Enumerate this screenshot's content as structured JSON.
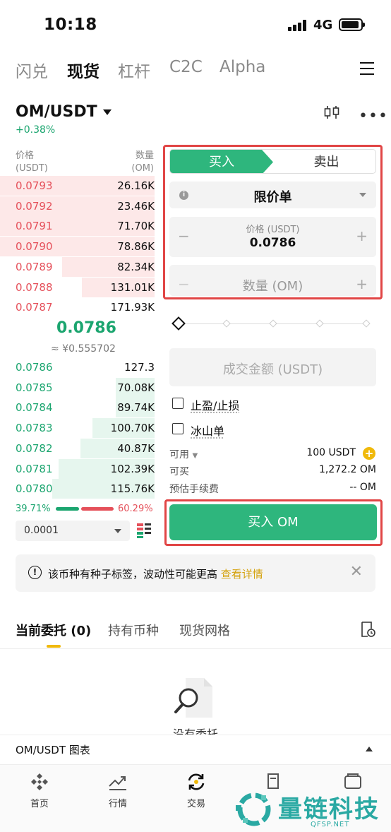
{
  "status": {
    "time": "10:18",
    "network": "4G"
  },
  "top_tabs": [
    "闪兑",
    "现货",
    "杠杆",
    "C2C",
    "Alpha"
  ],
  "pair": {
    "name": "OM/USDT",
    "change": "+0.38%"
  },
  "orderbook": {
    "price_header": "价格",
    "price_unit": "(USDT)",
    "qty_header": "数量",
    "qty_unit": "(OM)",
    "asks": [
      {
        "price": "0.0793",
        "qty": "26.16K",
        "depth": 0.27
      },
      {
        "price": "0.0792",
        "qty": "23.46K",
        "depth": 0.25
      },
      {
        "price": "0.0791",
        "qty": "71.70K",
        "depth": 0.45
      },
      {
        "price": "0.0790",
        "qty": "78.86K",
        "depth": 0.55
      },
      {
        "price": "0.0789",
        "qty": "82.34K",
        "depth": 0.6
      },
      {
        "price": "0.0788",
        "qty": "131.01K",
        "depth": 0.47
      },
      {
        "price": "0.0787",
        "qty": "171.93K",
        "depth": 0.0
      }
    ],
    "mid_price": "0.0786",
    "mid_cny": "≈ ¥0.555702",
    "bids": [
      {
        "price": "0.0786",
        "qty": "127.3",
        "depth": 0.0
      },
      {
        "price": "0.0785",
        "qty": "70.08K",
        "depth": 0.25
      },
      {
        "price": "0.0784",
        "qty": "89.74K",
        "depth": 0.25
      },
      {
        "price": "0.0783",
        "qty": "100.70K",
        "depth": 0.4
      },
      {
        "price": "0.0782",
        "qty": "40.87K",
        "depth": 0.48
      },
      {
        "price": "0.0781",
        "qty": "102.39K",
        "depth": 0.62
      },
      {
        "price": "0.0780",
        "qty": "115.76K",
        "depth": 0.66
      }
    ],
    "buy_ratio": "39.71%",
    "sell_ratio": "60.29%",
    "precision": "0.0001"
  },
  "form": {
    "buy_tab": "买入",
    "sell_tab": "卖出",
    "order_type": "限价单",
    "price_label": "价格 (USDT)",
    "price_value": "0.0786",
    "qty_placeholder": "数量 (OM)",
    "minus": "−",
    "plus": "+",
    "amount_placeholder": "成交金额 (USDT)",
    "tp_sl": "止盈/止损",
    "iceberg": "冰山单",
    "available_label": "可用",
    "available_value": "100 USDT",
    "can_buy_label": "可买",
    "can_buy_value": "1,272.2 OM",
    "fee_label": "预估手续费",
    "fee_value": "-- OM",
    "buy_button": "买入 OM"
  },
  "notice": {
    "text": "该币种有种子标签，波动性可能更高",
    "link": "查看详情"
  },
  "section_tabs": [
    "当前委托 (0)",
    "持有币种",
    "现货网格"
  ],
  "empty_text": "没有委托",
  "chart_bar": "OM/USDT 图表",
  "nav": [
    "首页",
    "行情",
    "交易"
  ],
  "watermark": {
    "big": "量链科技",
    "small": "QFSP.NET"
  }
}
